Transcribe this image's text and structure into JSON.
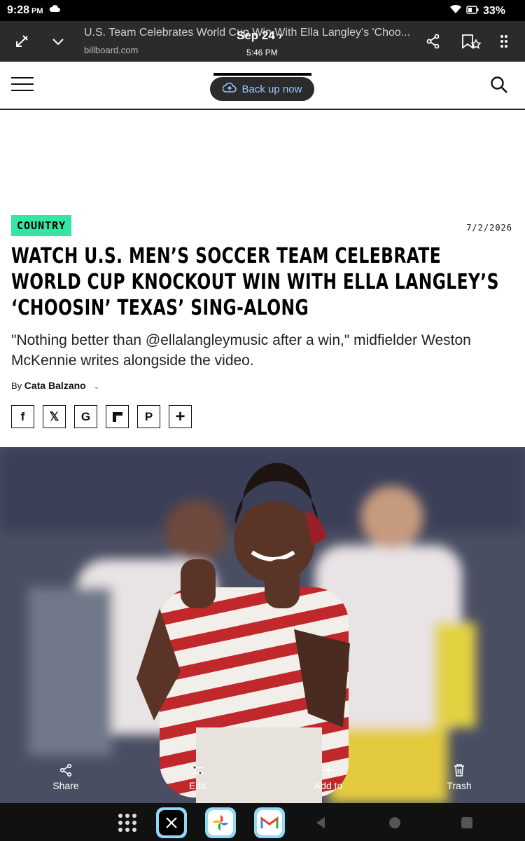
{
  "status": {
    "time": "9:28",
    "ampm": "PM",
    "battery": "33%"
  },
  "browser": {
    "title": "U.S. Team Celebrates World Cup Win With Ella Langley's 'Choo...",
    "url": "billboard.com",
    "overlay_date": "Sep 24 ›",
    "overlay_time": "5:46 PM"
  },
  "site": {
    "backup_label": "Back up now"
  },
  "article": {
    "category": "COUNTRY",
    "date": "7/2/2026",
    "headline": "WATCH U.S. MEN’S SOCCER TEAM CELEBRATE WORLD CUP KNOCKOUT WIN WITH ELLA LANGLEY’S ‘CHOOSIN’ TEXAS’ SING-ALONG",
    "dek": "\"Nothing better than @ellalangleymusic after a win,\" midfielder Weston McKennie writes alongside the video.",
    "by_label": "By",
    "author": "Cata Balzano"
  },
  "share_buttons": [
    "f",
    "𝕏",
    "G",
    "",
    "P",
    "+"
  ],
  "photo_actions": {
    "share": "Share",
    "edit": "Edit",
    "add_to": "Add to",
    "trash": "Trash"
  },
  "colors": {
    "accent": "#33e6a1",
    "topbar": "#2b2b2b"
  }
}
